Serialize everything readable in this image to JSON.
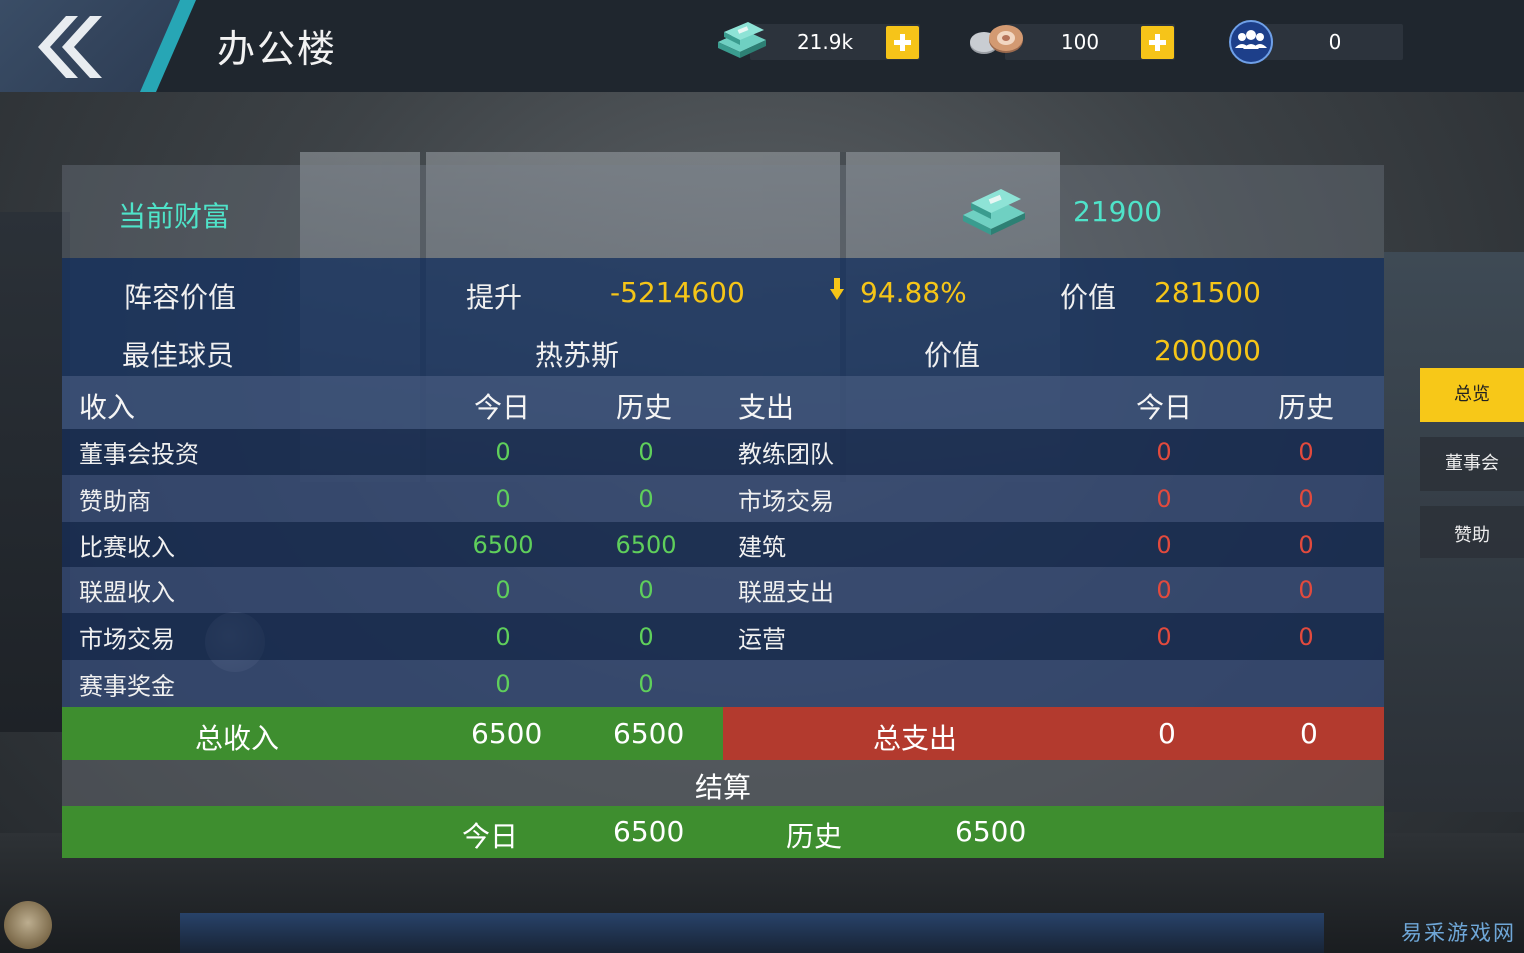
{
  "header": {
    "title": "办公楼",
    "cash": "21.9k",
    "chips": "100",
    "fans": "0"
  },
  "wealth": {
    "label": "当前财富",
    "value": "21900"
  },
  "summary": {
    "lineup_label": "阵容价值",
    "rise_label": "提升",
    "rise_value": "-5214600",
    "percent": "94.88%",
    "value_label": "价值",
    "lineup_value": "281500",
    "best_label": "最佳球员",
    "best_player": "热苏斯",
    "best_value_label": "价值",
    "best_value": "200000"
  },
  "table": {
    "income_header": "收入",
    "today_header": "今日",
    "history_header": "历史",
    "expense_header": "支出",
    "rows": [
      {
        "income": "董事会投资",
        "in_today": "0",
        "in_hist": "0",
        "expense": "教练团队",
        "ex_today": "0",
        "ex_hist": "0"
      },
      {
        "income": "赞助商",
        "in_today": "0",
        "in_hist": "0",
        "expense": "市场交易",
        "ex_today": "0",
        "ex_hist": "0"
      },
      {
        "income": "比赛收入",
        "in_today": "6500",
        "in_hist": "6500",
        "expense": "建筑",
        "ex_today": "0",
        "ex_hist": "0"
      },
      {
        "income": "联盟收入",
        "in_today": "0",
        "in_hist": "0",
        "expense": "联盟支出",
        "ex_today": "0",
        "ex_hist": "0"
      },
      {
        "income": "市场交易",
        "in_today": "0",
        "in_hist": "0",
        "expense": "运营",
        "ex_today": "0",
        "ex_hist": "0"
      },
      {
        "income": "赛事奖金",
        "in_today": "0",
        "in_hist": "0",
        "expense": "",
        "ex_today": "",
        "ex_hist": ""
      }
    ],
    "total_income_label": "总收入",
    "total_income_today": "6500",
    "total_income_hist": "6500",
    "total_expense_label": "总支出",
    "total_expense_today": "0",
    "total_expense_hist": "0"
  },
  "settlement": {
    "label": "结算",
    "today_label": "今日",
    "today_value": "6500",
    "history_label": "历史",
    "history_value": "6500"
  },
  "tabs": [
    "总览",
    "董事会",
    "赞助"
  ],
  "watermark": "易采游戏网",
  "colors": {
    "accent_teal": "#4fe3c9",
    "highlight_yellow": "#f5c518",
    "income_green": "#3e8e2f",
    "expense_red": "#b33a2e",
    "positive_text": "#5fcf5b",
    "negative_text": "#e24a3d"
  }
}
